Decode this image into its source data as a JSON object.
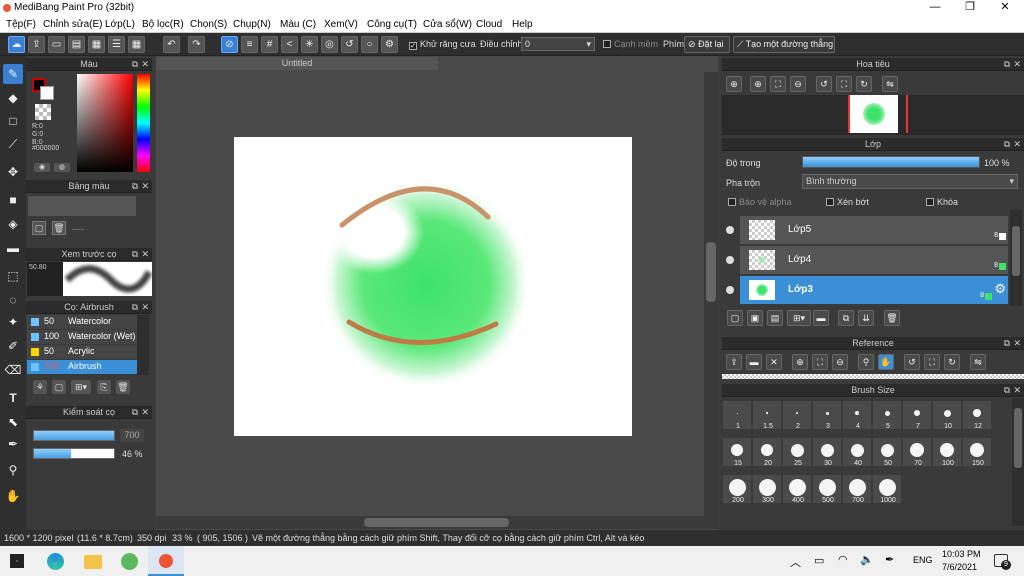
{
  "window": {
    "title": "MediBang Paint Pro (32bit)",
    "min": "—",
    "max": "❐",
    "close": "✕"
  },
  "menu": [
    "Tệp(F)",
    "Chỉnh sửa(E)",
    "Lớp(L)",
    "Bộ lọc(R)",
    "Chọn(S)",
    "Chụp(N)",
    "Màu (C)",
    "Xem(V)",
    "Công cụ(T)",
    "Cửa sổ(W)",
    "Cloud",
    "Help"
  ],
  "toolbar": {
    "antialias": "Khử răng cưa",
    "adjust": "Điều chỉnh",
    "adjust_value": "0",
    "smooth": "Cạnh mềm",
    "key": "Phím",
    "set": "Đặt lại",
    "straight": "Tạo một đường thẳng"
  },
  "canvas": {
    "tab": "Untitled"
  },
  "color_panel": {
    "title": "Màu",
    "r": "R:0",
    "g": "G:0",
    "b": "B:0",
    "hex": "#000000"
  },
  "palette_panel": {
    "title": "Bảng màu",
    "dashes": "----"
  },
  "brush_preview": {
    "title": "Xem trước cọ",
    "size": "50.80"
  },
  "brush_panel": {
    "title": "Cọ: Airbrush",
    "items": [
      {
        "size": "50",
        "name": "Watercolor",
        "color": "#6cc3ff"
      },
      {
        "size": "100",
        "name": "Watercolor (Wet)",
        "color": "#6cc3ff"
      },
      {
        "size": "50",
        "name": "Acrylic",
        "color": "#ffd200"
      },
      {
        "size": "700",
        "name": "Airbrush",
        "color": "#6cc3ff"
      }
    ]
  },
  "control_panel": {
    "title": "Kiểm soát cọ",
    "size": "700",
    "opacity": "46 %",
    "opacity_value": 0.46
  },
  "navigator": {
    "title": "Hoa tiêu"
  },
  "layer_panel": {
    "title": "Lớp",
    "opacity_label": "Độ trong",
    "opacity": "100 %",
    "opacity_value": 1.0,
    "blend_label": "Pha trộn",
    "blend": "Bình thường",
    "protect_alpha": "Bảo vệ alpha",
    "clipping": "Xén bớt",
    "lock": "Khóa",
    "layers": [
      {
        "name": "Lớp5",
        "num": "8"
      },
      {
        "name": "Lớp4",
        "num": "8"
      },
      {
        "name": "Lớp3",
        "num": "8"
      }
    ]
  },
  "reference": {
    "title": "Reference"
  },
  "brush_size": {
    "title": "Brush Size",
    "sizes": [
      "1",
      "1.5",
      "2",
      "3",
      "4",
      "5",
      "7",
      "10",
      "12",
      "15",
      "20",
      "25",
      "30",
      "40",
      "50",
      "70",
      "100",
      "150",
      "200",
      "300",
      "400",
      "500",
      "700",
      "1000"
    ]
  },
  "status": {
    "dims": "1600 * 1200 pixel",
    "cm": "(11.6 * 8.7cm)",
    "dpi": "350 dpi",
    "zoom": "33 %",
    "coords": "( 905, 1506 )",
    "hint": "Vẽ một đường thẳng bằng cách giữ phím Shift, Thay đổi cỡ cọ bằng cách giữ phím Ctrl, Alt và kéo"
  },
  "taskbar": {
    "lang": "ENG",
    "time": "10:03 PM",
    "date": "7/6/2021",
    "badge": "9"
  },
  "colors": {
    "accent": "#3a8fd6",
    "green": "#3ee26a",
    "arc": "#c8936a"
  }
}
